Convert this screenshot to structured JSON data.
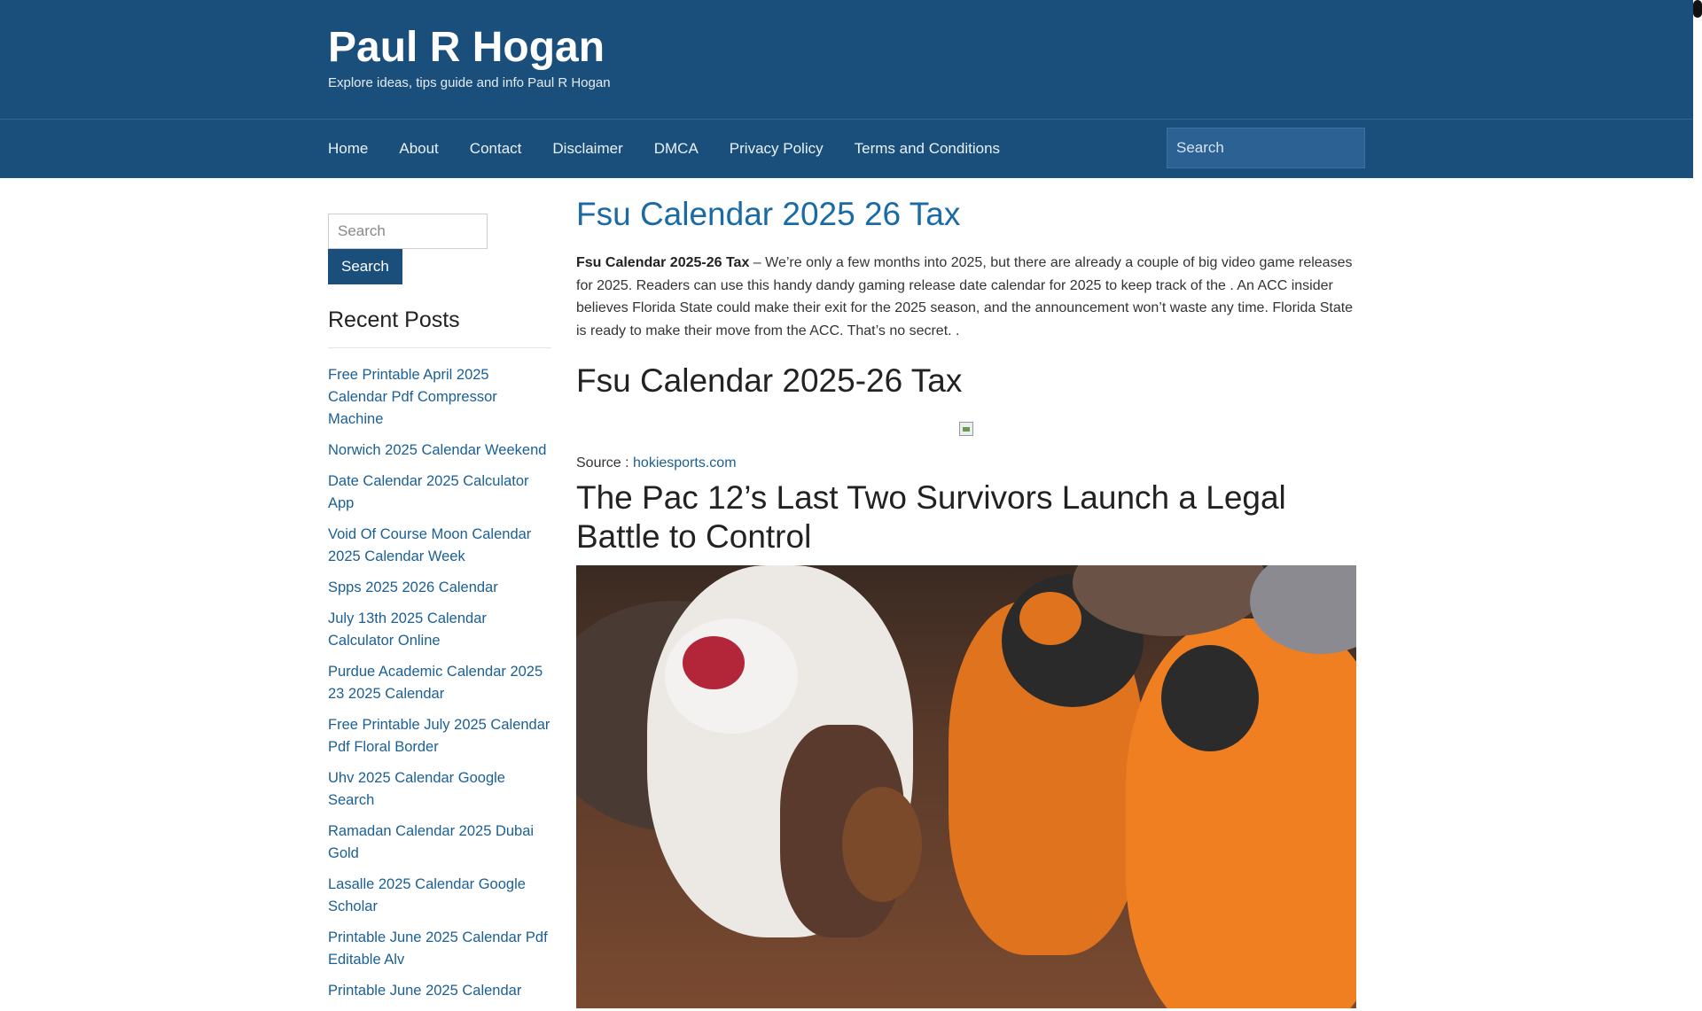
{
  "site": {
    "title": "Paul R Hogan",
    "tagline": "Explore ideas, tips guide and info Paul R Hogan"
  },
  "nav": {
    "items": [
      {
        "label": "Home"
      },
      {
        "label": "About"
      },
      {
        "label": "Contact"
      },
      {
        "label": "Disclaimer"
      },
      {
        "label": "DMCA"
      },
      {
        "label": "Privacy Policy"
      },
      {
        "label": "Terms and Conditions"
      }
    ],
    "search_placeholder": "Search"
  },
  "sidebar": {
    "search_placeholder": "Search",
    "search_button": "Search",
    "recent_title": "Recent Posts",
    "recent_posts": [
      "Free Printable April 2025 Calendar Pdf Compressor Machine",
      "Norwich 2025 Calendar Weekend",
      "Date Calendar 2025 Calculator App",
      "Void Of Course Moon Calendar 2025 Calendar Week",
      "Spps 2025 2026 Calendar",
      "July 13th 2025 Calendar Calculator Online",
      "Purdue Academic Calendar 2025 23 2025 Calendar",
      "Free Printable July 2025 Calendar Pdf Floral Border",
      "Uhv 2025 Calendar Google Search",
      "Ramadan Calendar 2025 Dubai Gold",
      "Lasalle 2025 Calendar Google Scholar",
      "Printable June 2025 Calendar Pdf Editable Alv",
      "Printable June 2025 Calendar"
    ]
  },
  "article": {
    "title": "Fsu Calendar 2025 26 Tax",
    "intro_strong": "Fsu Calendar 2025-26 Tax",
    "intro_text": " – We’re only a few months into 2025, but there are already a couple of big video game releases for 2025. Readers can use this handy dandy gaming release date calendar for 2025 to keep track of the . An ACC insider believes Florida State could make their exit for the 2025 season, and the announcement won’t waste any time. Florida State is ready to make their move from the ACC. That’s no secret. .",
    "h2": "Fsu Calendar 2025-26 Tax",
    "source_label": "Source : ",
    "source_link": "hokiesports.com",
    "h3": "The Pac 12’s Last Two Survivors Launch a Legal Battle to Control"
  }
}
